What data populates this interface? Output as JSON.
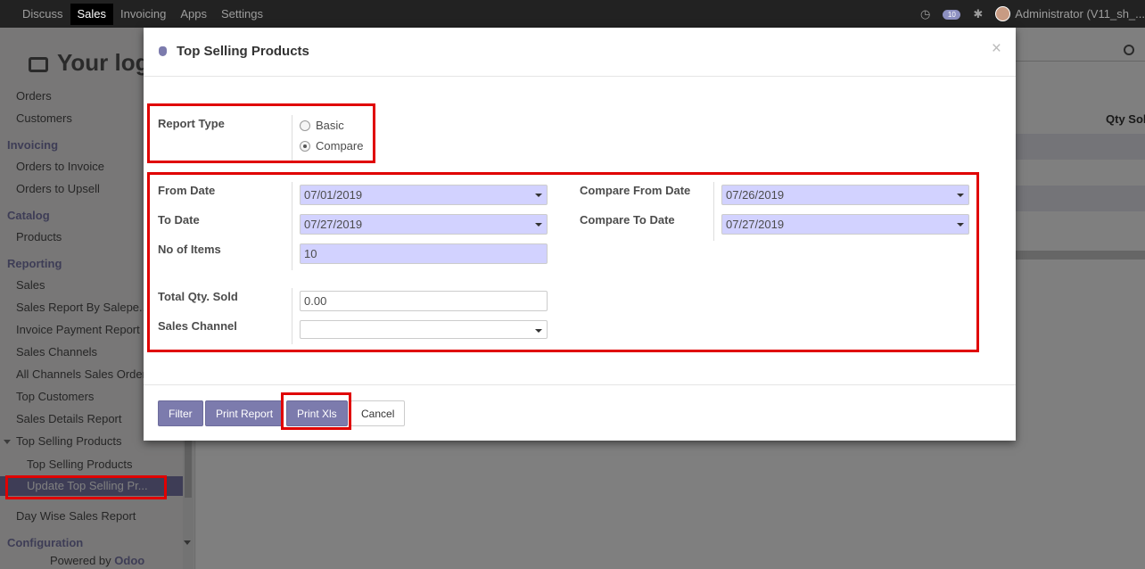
{
  "topbar": {
    "menus": [
      "Discuss",
      "Sales",
      "Invoicing",
      "Apps",
      "Settings"
    ],
    "active_menu": "Sales",
    "chat_count": "10",
    "user": "Administrator (V11_sh_..."
  },
  "sidebar": {
    "logo": "Your log",
    "items": {
      "orders": "Orders",
      "customers": "Customers",
      "invoicing": "Invoicing",
      "orders_to_invoice": "Orders to Invoice",
      "orders_to_upsell": "Orders to Upsell",
      "catalog": "Catalog",
      "products": "Products",
      "reporting": "Reporting",
      "sales": "Sales",
      "sales_report_by_salesperson": "Sales Report By Salepe...",
      "invoice_payment_report": "Invoice Payment Report",
      "sales_channels": "Sales Channels",
      "all_channels_sales_orders": "All Channels Sales Orders",
      "top_customers": "Top Customers",
      "sales_details_report": "Sales Details Report",
      "top_selling_products": "Top Selling Products",
      "top_selling_products_sub": "Top Selling Products",
      "update_top_selling": "Update Top Selling Pr...",
      "day_wise_sales_report": "Day Wise Sales Report",
      "configuration": "Configuration"
    },
    "powered_by": "Powered by",
    "powered_brand": "Odoo"
  },
  "background": {
    "qty_header": "Qty Sol"
  },
  "modal": {
    "title": "Top Selling Products",
    "close": "×",
    "report_type_label": "Report Type",
    "report_type_options": [
      "Basic",
      "Compare"
    ],
    "report_type_selected": "Compare",
    "from_date_label": "From Date",
    "from_date": "07/01/2019",
    "to_date_label": "To Date",
    "to_date": "07/27/2019",
    "no_of_items_label": "No of Items",
    "no_of_items": "10",
    "compare_from_label": "Compare From Date",
    "compare_from": "07/26/2019",
    "compare_to_label": "Compare To Date",
    "compare_to": "07/27/2019",
    "total_qty_label": "Total Qty. Sold",
    "total_qty": "0.00",
    "sales_channel_label": "Sales Channel",
    "sales_channel": "",
    "buttons": {
      "filter": "Filter",
      "print_report": "Print Report",
      "print_xls": "Print Xls",
      "cancel": "Cancel"
    }
  },
  "colors": {
    "accent": "#7c7bad",
    "highlight": "#e00000",
    "required_input": "#d2d2ff"
  }
}
